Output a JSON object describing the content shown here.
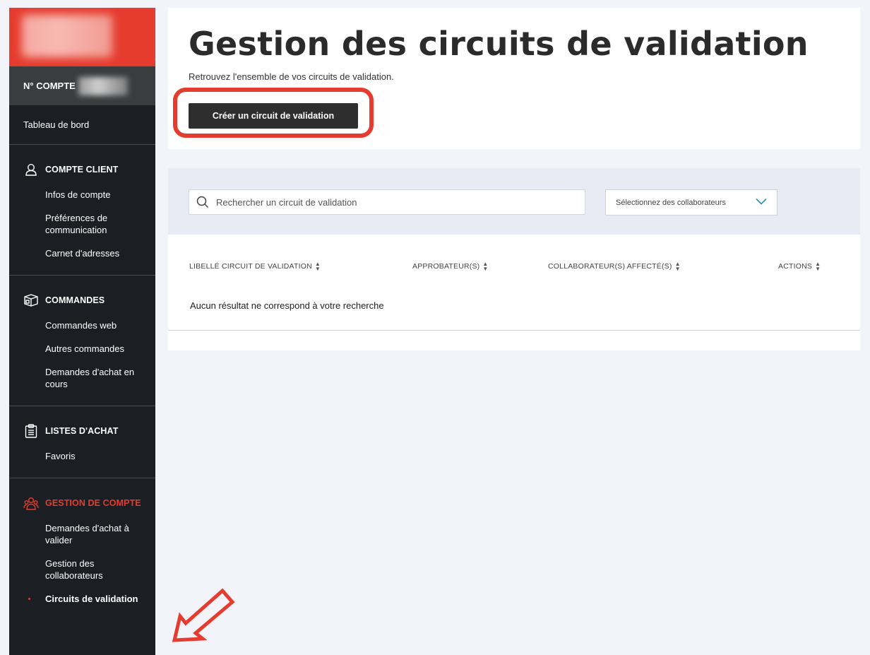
{
  "sidebar": {
    "account_label": "N° COMPTE",
    "dashboard": "Tableau de bord",
    "sections": [
      {
        "title": "COMPTE CLIENT",
        "icon": "user-icon",
        "items": [
          "Infos de compte",
          "Préférences de communication",
          "Carnet d'adresses"
        ]
      },
      {
        "title": "COMMANDES",
        "icon": "box-icon",
        "items": [
          "Commandes web",
          "Autres commandes",
          "Demandes d'achat en cours"
        ]
      },
      {
        "title": "LISTES D'ACHAT",
        "icon": "clipboard-list-icon",
        "items": [
          "Favoris"
        ]
      },
      {
        "title": "GESTION DE COMPTE",
        "icon": "team-icon",
        "items": [
          "Demandes d'achat à valider",
          "Gestion des collaborateurs",
          "Circuits de validation"
        ]
      }
    ]
  },
  "header": {
    "title": "Gestion des circuits de validation",
    "subtitle": "Retrouvez l'ensemble de vos circuits de validation.",
    "create_button": "Créer un circuit de validation"
  },
  "filters": {
    "search_placeholder": "Rechercher un circuit de validation",
    "collaborators_placeholder": "Sélectionnez des collaborateurs"
  },
  "table": {
    "columns": [
      "LIBELLÉ CIRCUIT DE VALIDATION",
      "APPROBATEUR(S)",
      "COLLABORATEUR(S) AFFECTÉ(S)",
      "ACTIONS"
    ],
    "empty_message": "Aucun résultat ne correspond à votre recherche"
  },
  "colors": {
    "brand_red": "#e63c2f",
    "sidebar_bg": "#1b1e22",
    "button_dark": "#2e2e2e",
    "chevron_teal": "#2a8fb8"
  }
}
